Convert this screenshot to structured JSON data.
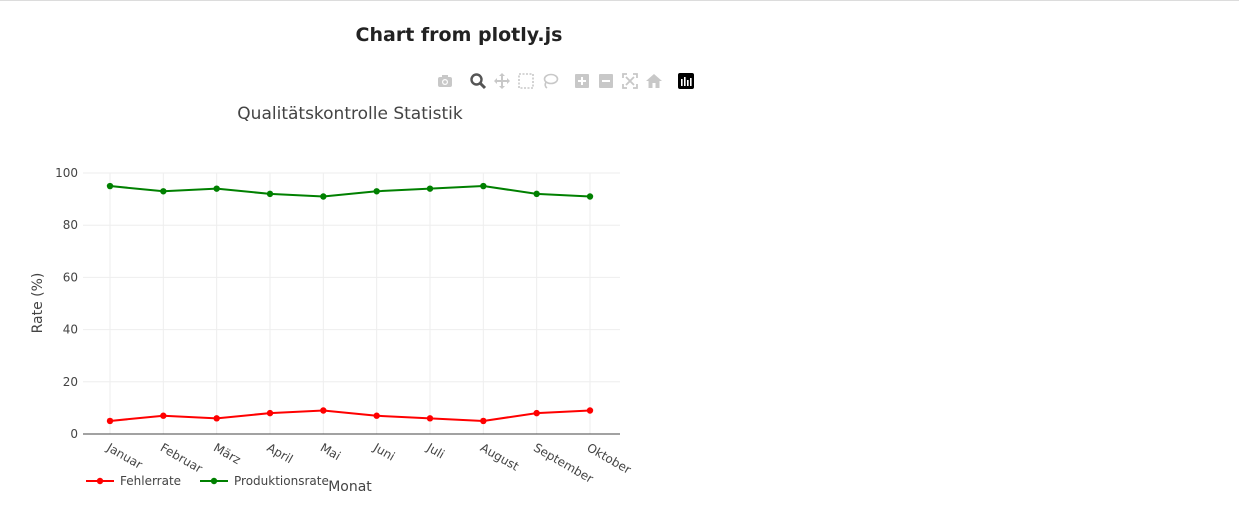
{
  "page": {
    "title": "Chart from plotly.js"
  },
  "modebar": {
    "buttons": [
      "camera-icon",
      "zoom-icon",
      "pan-icon",
      "box-select-icon",
      "lasso-select-icon",
      "zoom-in-icon",
      "zoom-out-icon",
      "autoscale-icon",
      "reset-axes-icon",
      "plotly-logo-icon"
    ]
  },
  "chart_data": {
    "type": "line",
    "title": "Qualitätskontrolle Statistik",
    "xlabel": "Monat",
    "ylabel": "Rate (%)",
    "categories": [
      "Januar",
      "Februar",
      "März",
      "April",
      "Mai",
      "Juni",
      "Juli",
      "August",
      "September",
      "Oktober"
    ],
    "ylim": [
      0,
      100
    ],
    "yticks": [
      "0",
      "20",
      "40",
      "60",
      "80",
      "100"
    ],
    "grid": true,
    "legend_position": "bottom-left",
    "series": [
      {
        "name": "Fehlerrate",
        "color": "#ff0000",
        "values": [
          5,
          7,
          6,
          8,
          9,
          7,
          6,
          5,
          8,
          9
        ]
      },
      {
        "name": "Produktionsrate",
        "color": "#008000",
        "values": [
          95,
          93,
          94,
          92,
          91,
          93,
          94,
          95,
          92,
          91
        ]
      }
    ]
  }
}
